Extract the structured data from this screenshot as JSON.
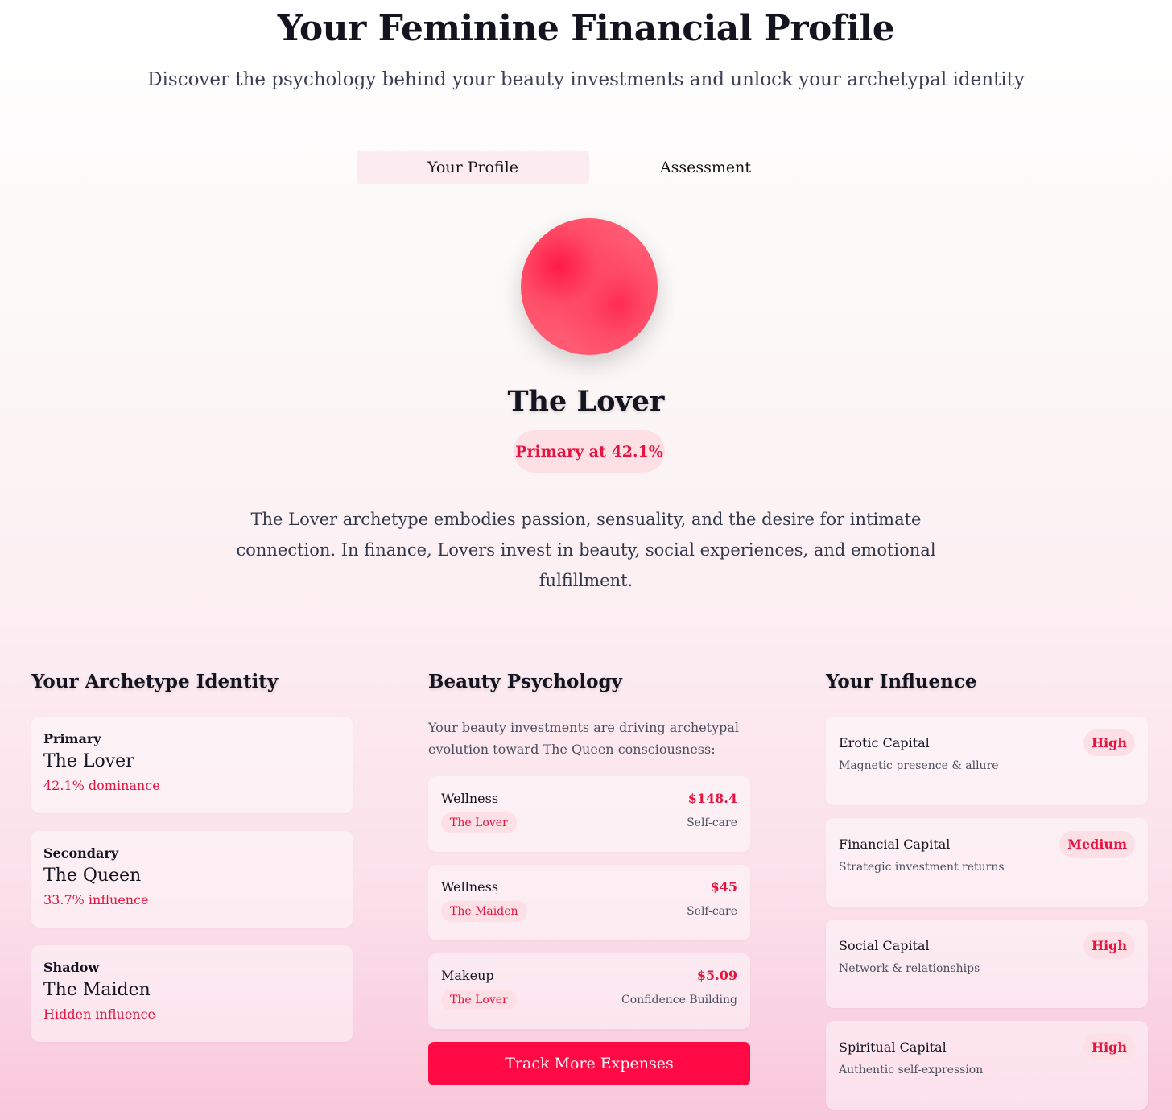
{
  "header": {
    "title": "Your Feminine Financial Profile",
    "subtitle": "Discover the psychology behind your beauty investments and unlock your archetypal identity"
  },
  "tabs": [
    {
      "label": "Your Profile",
      "active": true
    },
    {
      "label": "Assessment",
      "active": false
    }
  ],
  "hero": {
    "archetype": "The Lover",
    "badge": "Primary at 42.1%",
    "description": "The Lover archetype embodies passion, sensuality, and the desire for intimate connection. In finance, Lovers invest in beauty, social experiences, and emotional fulfillment."
  },
  "identity": {
    "heading": "Your Archetype Identity",
    "items": [
      {
        "label": "Primary",
        "name": "The Lover",
        "note": "42.1% dominance"
      },
      {
        "label": "Secondary",
        "name": "The Queen",
        "note": "33.7% influence"
      },
      {
        "label": "Shadow",
        "name": "The Maiden",
        "note": "Hidden influence"
      }
    ]
  },
  "beauty": {
    "heading": "Beauty Psychology",
    "intro": "Your beauty investments are driving archetypal evolution toward The Queen consciousness:",
    "expenses": [
      {
        "category": "Wellness",
        "amount": "$148.4",
        "archetype": "The Lover",
        "purpose": "Self-care"
      },
      {
        "category": "Wellness",
        "amount": "$45",
        "archetype": "The Maiden",
        "purpose": "Self-care"
      },
      {
        "category": "Makeup",
        "amount": "$5.09",
        "archetype": "The Lover",
        "purpose": "Confidence Building"
      }
    ],
    "button_label": "Track More Expenses"
  },
  "influence": {
    "heading": "Your Influence",
    "items": [
      {
        "name": "Erotic Capital",
        "level": "High",
        "desc": "Magnetic presence & allure"
      },
      {
        "name": "Financial Capital",
        "level": "Medium",
        "desc": "Strategic investment returns"
      },
      {
        "name": "Social Capital",
        "level": "High",
        "desc": "Network & relationships"
      },
      {
        "name": "Spiritual Capital",
        "level": "High",
        "desc": "Authentic self-expression"
      }
    ]
  },
  "colors": {
    "accent": "#e5133f",
    "button": "#ff0a45",
    "orb": "#ff3a5c"
  }
}
